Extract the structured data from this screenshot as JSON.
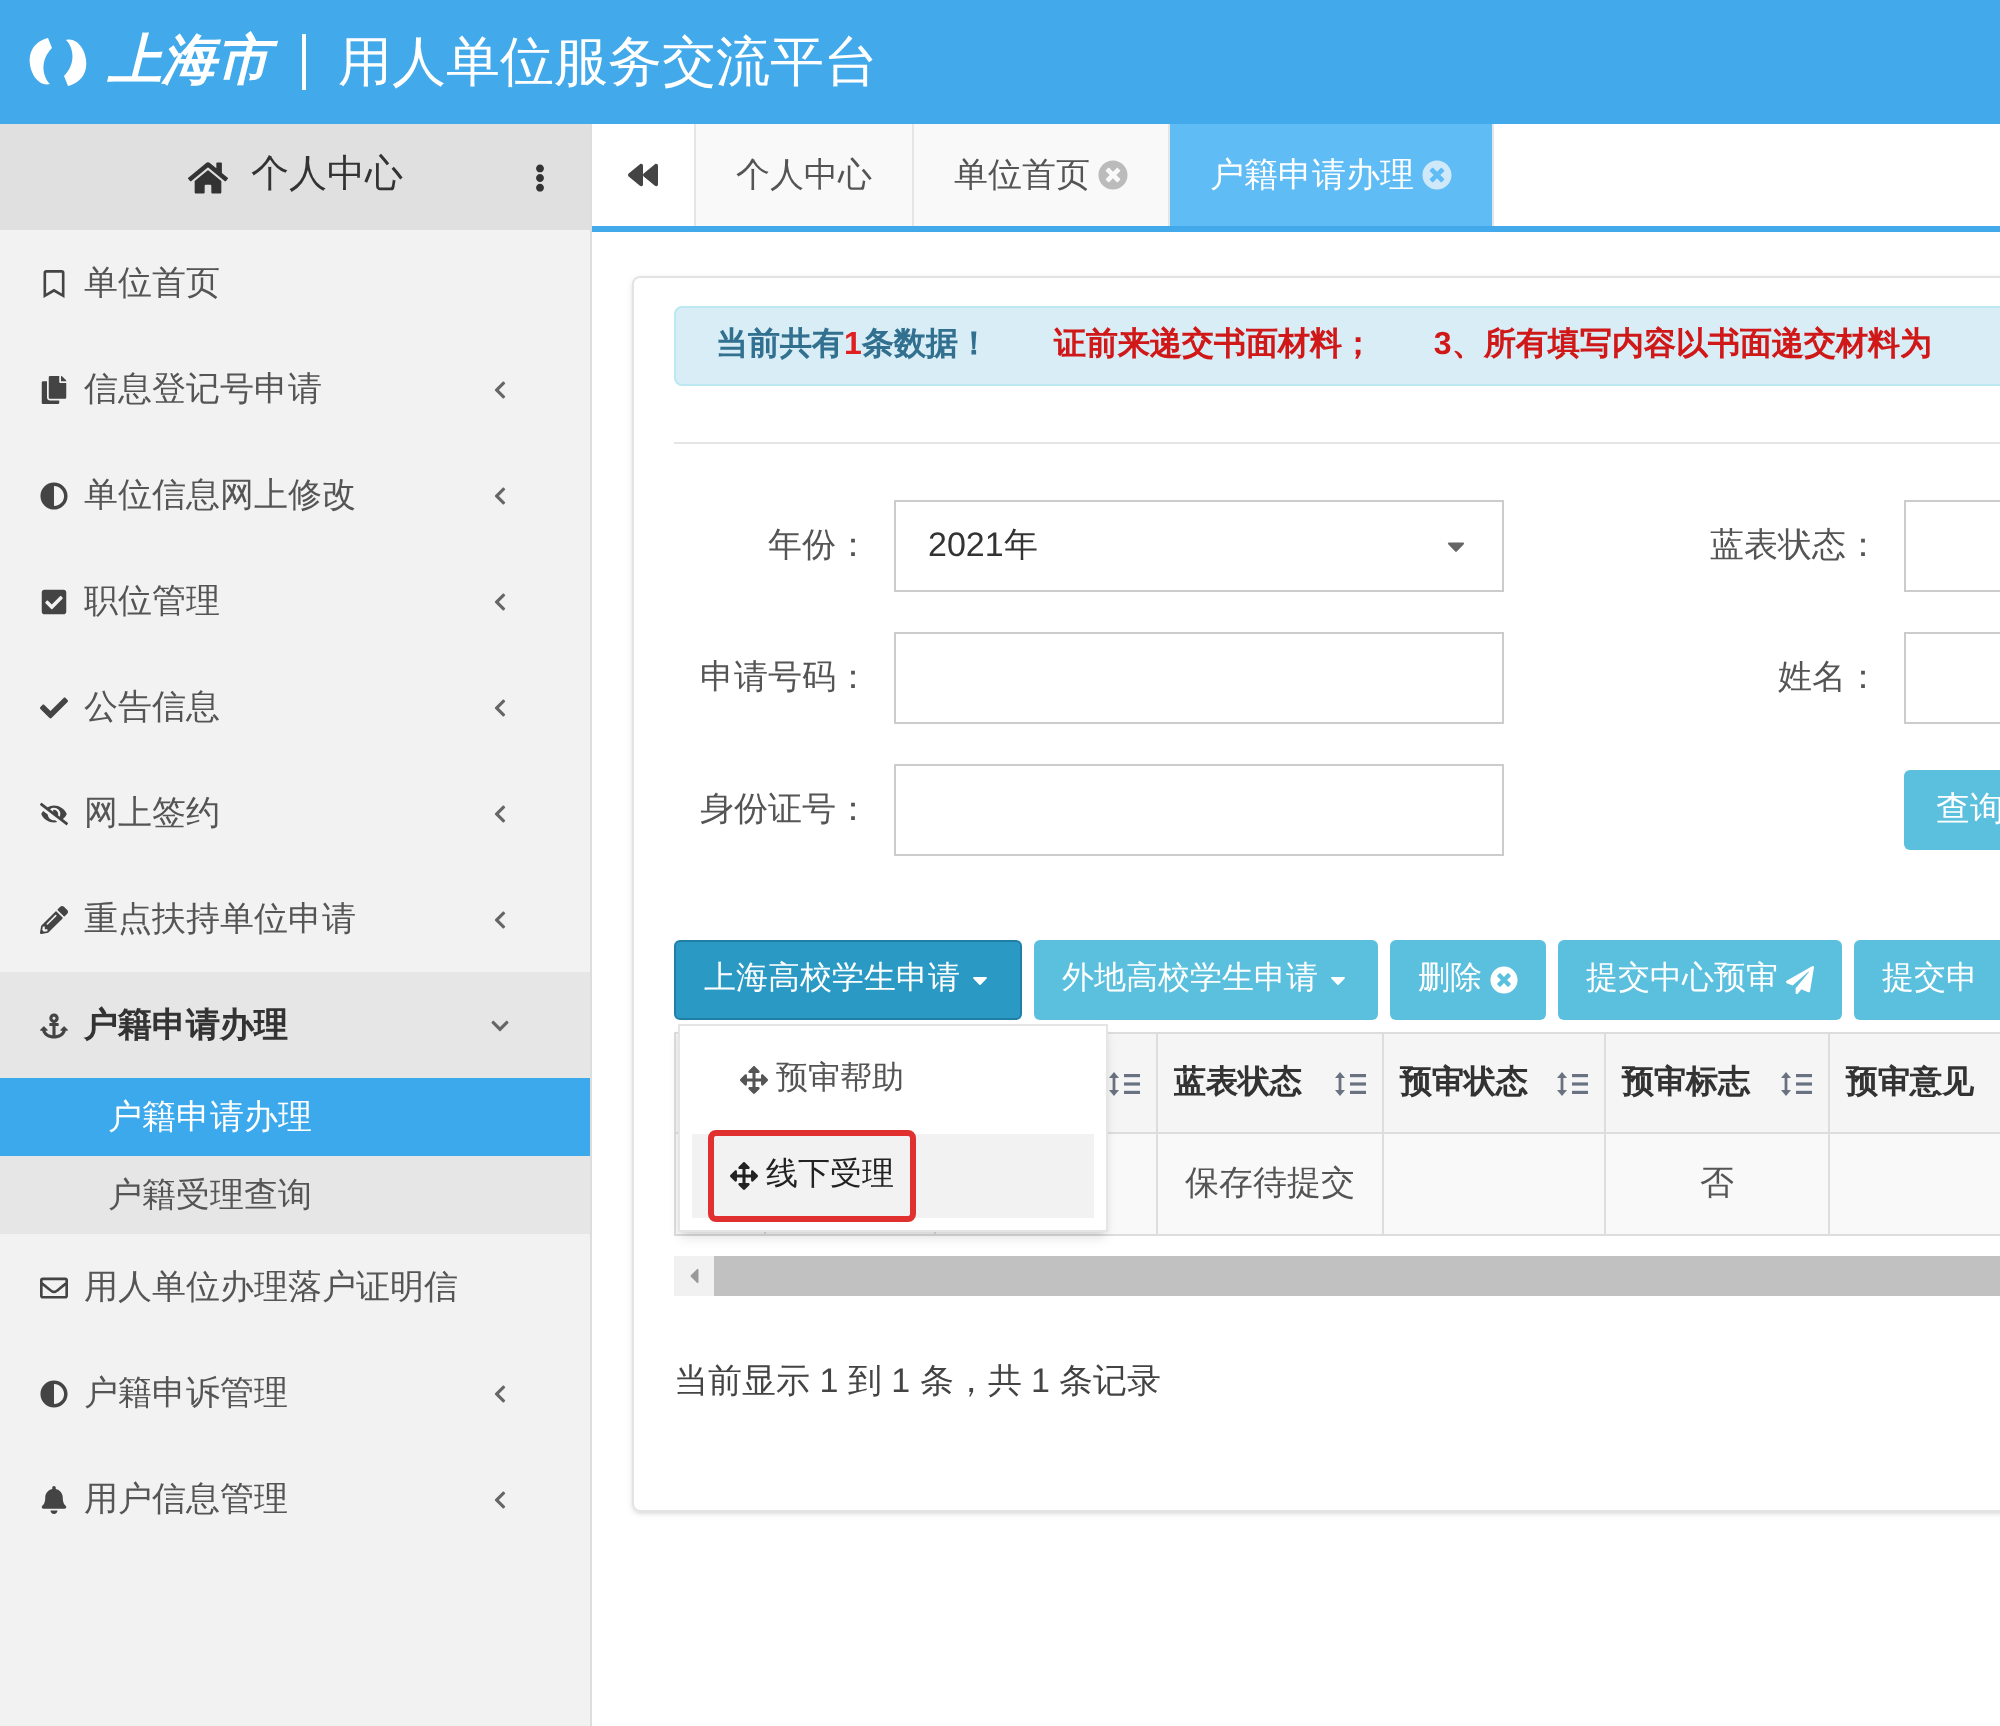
{
  "header": {
    "city": "上海市",
    "title": "用人单位服务交流平台"
  },
  "sidebar": {
    "title": "个人中心",
    "items": [
      {
        "kind": "link",
        "label": "单位首页"
      },
      {
        "kind": "group",
        "label": "信息登记号申请",
        "expanded": false
      },
      {
        "kind": "group",
        "label": "单位信息网上修改",
        "expanded": false
      },
      {
        "kind": "group",
        "label": "职位管理",
        "expanded": false
      },
      {
        "kind": "group",
        "label": "公告信息",
        "expanded": false
      },
      {
        "kind": "group",
        "label": "网上签约",
        "expanded": false
      },
      {
        "kind": "group",
        "label": "重点扶持单位申请",
        "expanded": false
      },
      {
        "kind": "group",
        "label": "户籍申请办理",
        "expanded": true,
        "children": [
          {
            "label": "户籍申请办理",
            "selected": true
          },
          {
            "label": "户籍受理查询",
            "selected": false
          }
        ]
      },
      {
        "kind": "link",
        "label": "用人单位办理落户证明信"
      },
      {
        "kind": "group",
        "label": "户籍申诉管理",
        "expanded": false
      },
      {
        "kind": "group",
        "label": "用户信息管理",
        "expanded": false
      }
    ]
  },
  "tabs": [
    {
      "label": "个人中心",
      "closable": false,
      "selected": false
    },
    {
      "label": "单位首页",
      "closable": true,
      "selected": false
    },
    {
      "label": "户籍申请办理",
      "closable": true,
      "selected": true
    }
  ],
  "notice": {
    "prefix": "当前共有",
    "count": "1",
    "suffix": "条数据！",
    "scrolling": [
      "证前来递交书面材料；",
      "3、所有填写内容以书面递交材料为"
    ]
  },
  "form": {
    "fields": [
      {
        "kind": "select",
        "label": "年份：",
        "value": "2021年"
      },
      {
        "kind": "input",
        "label": "蓝表状态："
      },
      {
        "kind": "input",
        "label": "申请号码："
      },
      {
        "kind": "input",
        "label": "姓名："
      },
      {
        "kind": "input",
        "label": "身份证号："
      },
      {
        "kind": "button",
        "label": "查询"
      }
    ]
  },
  "toolbar": [
    {
      "label": "上海高校学生申请",
      "kind": "dropdown",
      "selected": true
    },
    {
      "label": "外地高校学生申请",
      "kind": "dropdown",
      "selected": false
    },
    {
      "label": "删除",
      "kind": "delete",
      "selected": false
    },
    {
      "label": "提交中心预审",
      "kind": "send",
      "selected": false
    },
    {
      "label": "提交申",
      "kind": "plain",
      "selected": false
    }
  ],
  "dropdown_menu": [
    {
      "label": "预审帮助",
      "hovered": false,
      "annotated": false
    },
    {
      "label": "线下受理",
      "hovered": true,
      "annotated": true
    }
  ],
  "table": {
    "columns": [
      {},
      {},
      {
        "sortable": true
      },
      {
        "label": "蓝表状态",
        "sortable": true
      },
      {
        "label": "预审状态",
        "sortable": true
      },
      {
        "label": "预审标志",
        "sortable": true
      },
      {
        "label": "预审意见"
      }
    ],
    "rows": [
      [
        "",
        "",
        "",
        "保存待提交",
        "",
        "否",
        ""
      ]
    ]
  },
  "footer": "当前显示 1 到 1 条，共 1 条记录"
}
